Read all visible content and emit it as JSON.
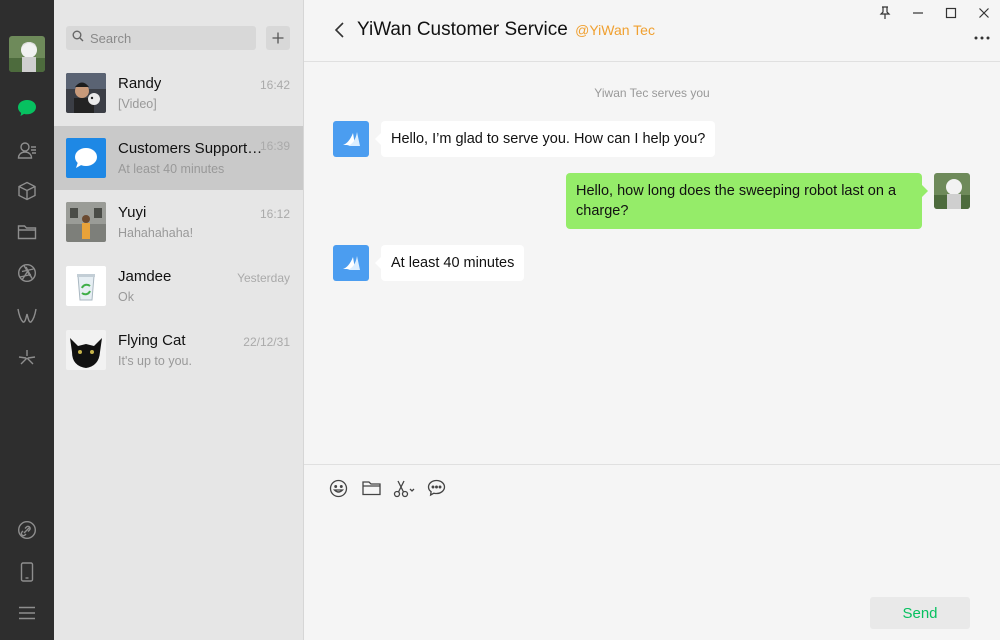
{
  "colors": {
    "rail": "#2e2e2e",
    "accent": "#07c160",
    "outgoing_bubble": "#95ec69",
    "org_tag": "#f0a030"
  },
  "rail": {
    "icons": [
      "chat-icon",
      "contacts-icon",
      "box-icon",
      "folder-icon",
      "moments-icon",
      "channels-icon",
      "miniprogram-icon",
      "link-icon",
      "phone-icon",
      "menu-icon"
    ]
  },
  "search": {
    "placeholder": "Search"
  },
  "conversations": [
    {
      "name": "Randy",
      "preview": "[Video]",
      "time": "16:42"
    },
    {
      "name": "Customers Support…",
      "preview": "At least 40 minutes",
      "time": "16:39"
    },
    {
      "name": "Yuyi",
      "preview": "Hahahahaha!",
      "time": "16:12"
    },
    {
      "name": "Jamdee",
      "preview": "Ok",
      "time": "Yesterday"
    },
    {
      "name": "Flying Cat",
      "preview": "It's up to you.",
      "time": "22/12/31"
    }
  ],
  "chat": {
    "title": "YiWan Customer Service",
    "org": "@YiWan Tec",
    "system_note": "Yiwan Tec serves you",
    "messages": [
      {
        "from": "service",
        "text": "Hello, I’m glad to serve you. How can I help you?"
      },
      {
        "from": "me",
        "text": "Hello, how long does the sweeping robot last on a charge?"
      },
      {
        "from": "service",
        "text": "At least 40 minutes"
      }
    ]
  },
  "composer": {
    "send_label": "Send"
  }
}
